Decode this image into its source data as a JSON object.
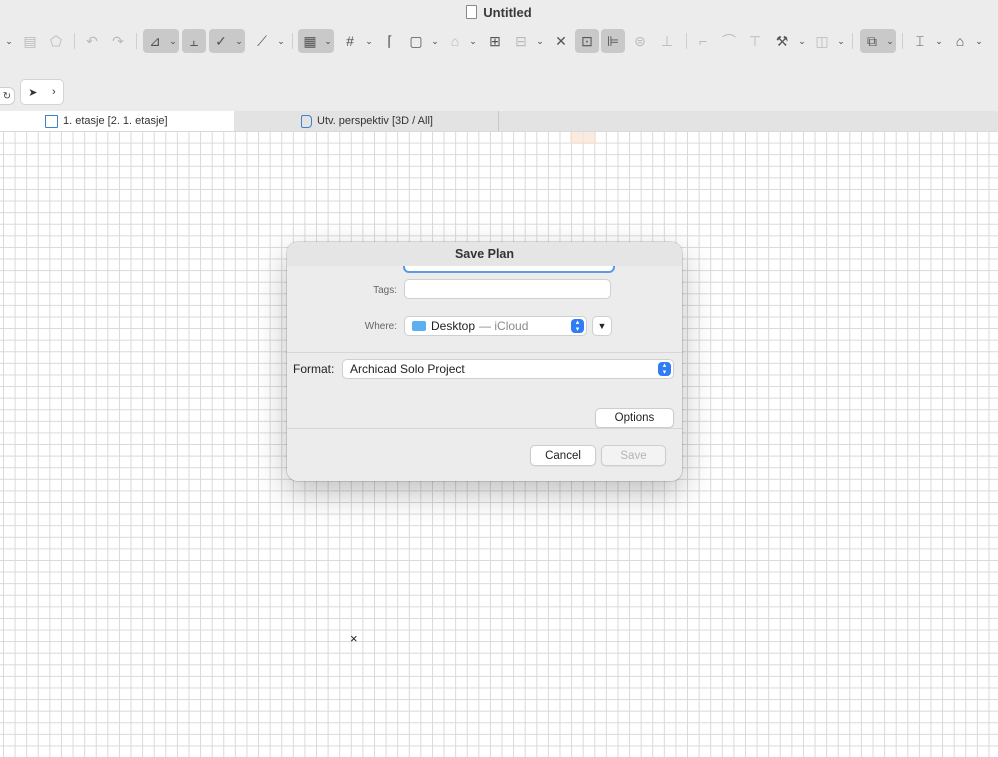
{
  "window": {
    "title": "Untitled"
  },
  "toolbar": {
    "icons": [
      "chevron-down-icon",
      "lines-icon",
      "drawing-icon",
      "undo-icon",
      "redo-icon",
      "angle-icon",
      "chevron-down-icon",
      "baseline-icon",
      "tick-icon",
      "chevron-down-icon",
      "slash-icon",
      "chevron-down-icon",
      "plan-icon",
      "chevron-down-icon",
      "grid-icon",
      "chevron-down-icon",
      "corner-icon",
      "frame-icon",
      "chevron-down-icon",
      "lock-icon",
      "chevron-down-icon",
      "ruler-icon",
      "align-icon",
      "chevron-down-icon",
      "scissors-icon",
      "snap-icon",
      "guide-icon",
      "stack-icon",
      "distribute-icon",
      "fillet-icon",
      "curve-icon",
      "elevate-icon",
      "magic-icon",
      "chevron-down-icon",
      "panels-icon",
      "chevron-down-icon",
      "group-icon",
      "chevron-down-icon",
      "beam-icon",
      "chevron-down-icon",
      "roof-icon",
      "chevron-down-icon"
    ]
  },
  "arrow_tool": {
    "more": "›"
  },
  "tabs": [
    {
      "label": "1. etasje [2. 1. etasje]",
      "active": true
    },
    {
      "label": "Utv. perspektiv [3D / All]",
      "active": false
    }
  ],
  "dialog": {
    "title": "Save Plan",
    "tags_label": "Tags:",
    "tags_value": "",
    "where_label": "Where:",
    "where_folder": "Desktop",
    "where_location": "— iCloud",
    "format_label": "Format:",
    "format_value": "Archicad Solo Project",
    "options_button": "Options",
    "cancel_button": "Cancel",
    "save_button": "Save"
  },
  "canvas": {
    "cursor_marker": "×"
  }
}
